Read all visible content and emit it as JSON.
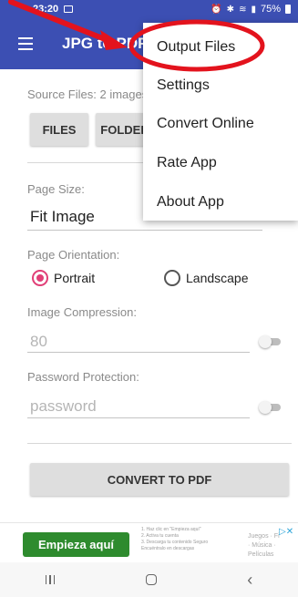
{
  "status_bar": {
    "time": "23:20",
    "battery": "75%",
    "icons": [
      "gallery-icon",
      "alarm-icon",
      "bluetooth-icon",
      "wifi-icon",
      "signal-icon",
      "battery-icon"
    ]
  },
  "app_bar": {
    "title": "JPG to PDF"
  },
  "source": {
    "label": "Source Files: 2 images",
    "files_button": "FILES",
    "folder_button": "FOLDER"
  },
  "page_size": {
    "label": "Page Size:",
    "value": "Fit Image"
  },
  "orientation": {
    "label": "Page Orientation:",
    "options": [
      "Portrait",
      "Landscape"
    ],
    "selected": "Portrait"
  },
  "compression": {
    "label": "Image Compression:",
    "value": "80",
    "enabled": false
  },
  "password": {
    "label": "Password Protection:",
    "placeholder": "password",
    "enabled": false
  },
  "convert_button": "CONVERT TO PDF",
  "menu": {
    "items": [
      "Output Files",
      "Settings",
      "Convert Online",
      "Rate App",
      "About App"
    ]
  },
  "ad": {
    "cta": "Empieza aquí",
    "steps": [
      "1. Haz clic en \"Empieza aquí\"",
      "2. Activa tu cuenta",
      "3. Descarga tu contenido Seguro",
      "Encuéntralo en descargas"
    ],
    "side": [
      "Juegos · Fi",
      "· Música ·",
      "Películas"
    ]
  },
  "colors": {
    "primary": "#3c4fb3",
    "accent": "#e13f77",
    "annotation": "#e3131d",
    "ad_cta": "#2e8b2e"
  }
}
